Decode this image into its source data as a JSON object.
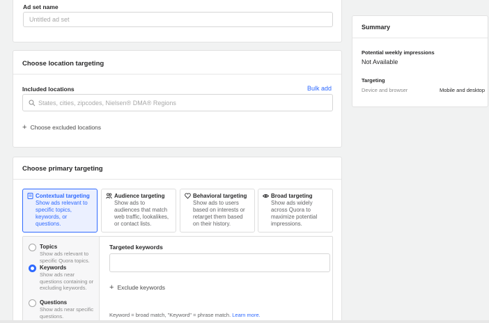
{
  "adset": {
    "name_label": "Ad set name",
    "name_placeholder": "Untitled ad set"
  },
  "location": {
    "title": "Choose location targeting",
    "included_label": "Included locations",
    "bulk_add": "Bulk add",
    "search_placeholder": "States, cities, zipcodes, Nielsen® DMA® Regions",
    "excluded_link": "Choose excluded locations"
  },
  "primary": {
    "title": "Choose primary targeting",
    "tiles": [
      {
        "icon": "document-icon",
        "title": "Contextual targeting",
        "desc": "Show ads relevant to specific topics, keywords, or questions.",
        "selected": true
      },
      {
        "icon": "people-icon",
        "title": "Audience targeting",
        "desc": "Show ads to audiences that match web traffic, lookalikes, or contact lists.",
        "selected": false
      },
      {
        "icon": "heart-icon",
        "title": "Behavioral targeting",
        "desc": "Show ads to users based on interests or retarget them based on their history.",
        "selected": false
      },
      {
        "icon": "eye-icon",
        "title": "Broad targeting",
        "desc": "Show ads widely across Quora to maximize potential impressions.",
        "selected": false
      }
    ],
    "options": [
      {
        "label": "Topics",
        "desc": "Show ads relevant to specific Quora topics.",
        "selected": false
      },
      {
        "label": "Keywords",
        "desc": "Show ads near questions containing or excluding keywords.",
        "selected": true
      },
      {
        "label": "Questions",
        "desc": "Show ads near specific questions.",
        "selected": false
      }
    ],
    "keywords_label": "Targeted keywords",
    "exclude_link": "Exclude keywords",
    "footnote": "Keyword = broad match, \"Keyword\" = phrase match.",
    "learn_more": "Learn more."
  },
  "summary": {
    "title": "Summary",
    "impressions_label": "Potential weekly impressions",
    "impressions_value": "Not Available",
    "targeting_label": "Targeting",
    "device_key": "Device and browser",
    "device_value": "Mobile and desktop"
  },
  "colors": {
    "accent": "#2e69ff",
    "background": "#f1f2f2"
  }
}
